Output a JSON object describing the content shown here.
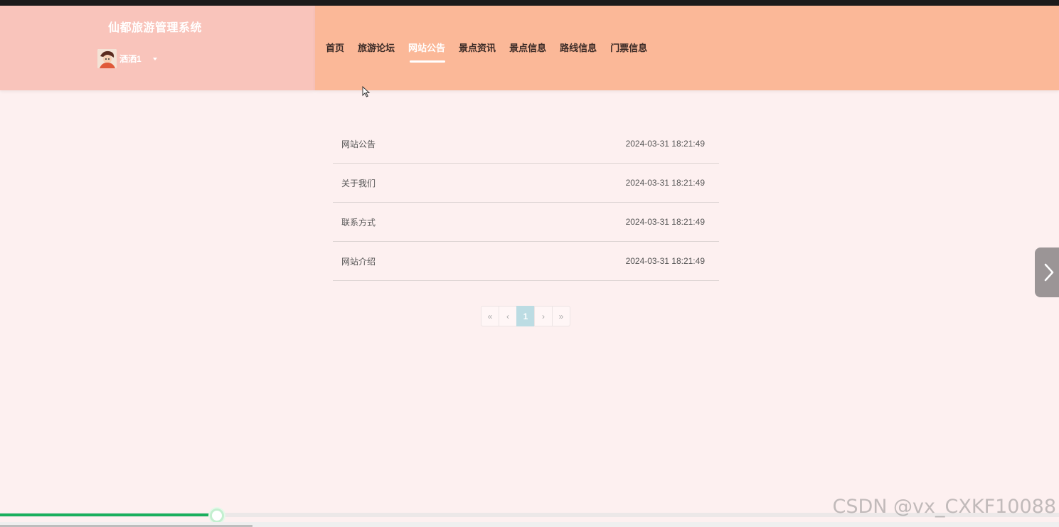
{
  "header": {
    "site_title": "仙都旅游管理系统",
    "user": {
      "name": "洒洒1"
    }
  },
  "nav": {
    "items": [
      {
        "label": "首页"
      },
      {
        "label": "旅游论坛"
      },
      {
        "label": "网站公告"
      },
      {
        "label": "景点资讯"
      },
      {
        "label": "景点信息"
      },
      {
        "label": "路线信息"
      },
      {
        "label": "门票信息"
      }
    ],
    "active_label": "网站公告"
  },
  "notices": [
    {
      "title": "网站公告",
      "date": "2024-03-31 18:21:49"
    },
    {
      "title": "关于我们",
      "date": "2024-03-31 18:21:49"
    },
    {
      "title": "联系方式",
      "date": "2024-03-31 18:21:49"
    },
    {
      "title": "网站介绍",
      "date": "2024-03-31 18:21:49"
    }
  ],
  "pagination": {
    "first": "«",
    "prev": "‹",
    "current": "1",
    "next": "›",
    "last": "»"
  },
  "video_player": {
    "progress_fraction": 0.205
  },
  "watermark": "CSDN @vx_CXKF10088",
  "colors": {
    "brand_panel": "#f9c4bb",
    "nav_panel": "#fbb898",
    "page_background": "#fdf0f0",
    "active_page": "#bcdce3",
    "progress": "#1aaf5d"
  },
  "icons": {
    "user_avatar": "avatar-icon",
    "user_menu": "caret-down-icon",
    "side_next": "chevron-right-icon"
  }
}
